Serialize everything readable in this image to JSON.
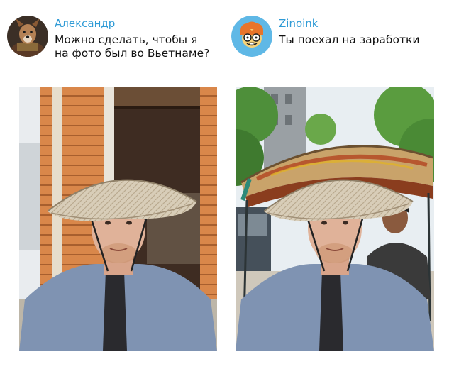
{
  "comments": [
    {
      "author": "Александр",
      "text_lines": [
        "Можно сделать, чтобы я",
        "на фото был во Вьетнаме?"
      ],
      "avatar_icon": "dog-portrait-avatar"
    },
    {
      "author": "Zinoink",
      "text_lines": [
        "Ты поехал на заработки"
      ],
      "avatar_icon": "cartoon-face-avatar"
    }
  ],
  "photos": [
    {
      "name": "original-photo",
      "scene": "man in conical straw hat in front of wooden house"
    },
    {
      "name": "edited-photo",
      "scene": "same man edited into a rickshaw with driver behind"
    }
  ],
  "colors": {
    "author": "#2f9bd6",
    "text": "#111111",
    "background": "#ffffff"
  }
}
